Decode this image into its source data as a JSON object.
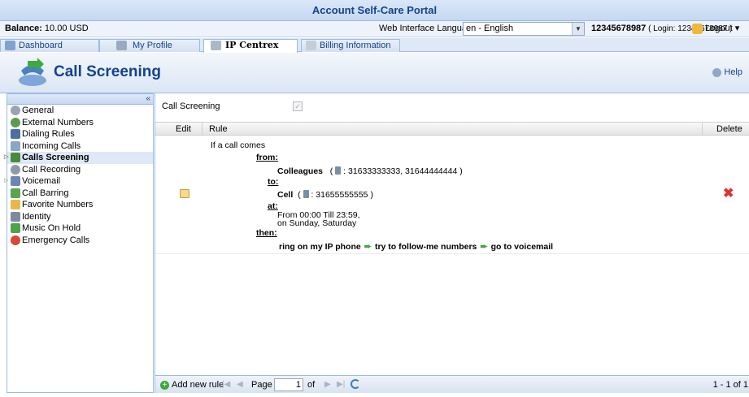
{
  "app": {
    "title": "Account Self-Care Portal"
  },
  "infobar": {
    "balance_label": "Balance:",
    "balance_value": "10.00 USD",
    "lang_label": "Web Interface Language:",
    "lang_value": "en - English",
    "account": "12345678987",
    "login": "( Login: 12345678987 )",
    "logout": "Logout"
  },
  "tabs": [
    {
      "label": "Dashboard"
    },
    {
      "label": "My Profile"
    },
    {
      "label": "IP Centrex"
    },
    {
      "label": "Billing Information"
    }
  ],
  "header": {
    "title": "Call Screening",
    "help": "Help"
  },
  "sidebar": {
    "items": [
      {
        "label": "General",
        "icon": "gear-icon"
      },
      {
        "label": "External Numbers",
        "icon": "globe-icon"
      },
      {
        "label": "Dialing Rules",
        "icon": "rules-icon"
      },
      {
        "label": "Incoming Calls",
        "icon": "incoming-icon"
      },
      {
        "label": "Calls Screening",
        "icon": "screening-icon"
      },
      {
        "label": "Call Recording",
        "icon": "recording-icon"
      },
      {
        "label": "Voicemail",
        "icon": "voicemail-icon"
      },
      {
        "label": "Call Barring",
        "icon": "barring-icon"
      },
      {
        "label": "Favorite Numbers",
        "icon": "favorite-icon"
      },
      {
        "label": "Identity",
        "icon": "identity-icon"
      },
      {
        "label": "Music On Hold",
        "icon": "music-icon"
      },
      {
        "label": "Emergency Calls",
        "icon": "emergency-icon"
      }
    ]
  },
  "main": {
    "call_screening_label": "Call Screening",
    "columns": {
      "edit": "Edit",
      "rule": "Rule",
      "delete": "Delete"
    },
    "rule": {
      "intro": "If a call comes",
      "from_kw": "from:",
      "from_name": "Colleagues",
      "from_open": "(",
      "from_numbers": ": 31633333333, 31644444444 )",
      "to_kw": "to:",
      "to_name": "Cell",
      "to_open": "(",
      "to_numbers": ": 31655555555 )",
      "at_kw": "at:",
      "at_time": "From 00:00 Till 23:59,",
      "at_days": "on Sunday, Saturday",
      "then_kw": "then:",
      "action_1": "ring on my IP phone",
      "action_2": "try to follow-me numbers",
      "action_3": "go to voicemail"
    }
  },
  "pager": {
    "add_label": "Add new rule",
    "page_label": "Page",
    "page_value": "1",
    "of_label": "of",
    "range": "1 - 1 of 1"
  }
}
